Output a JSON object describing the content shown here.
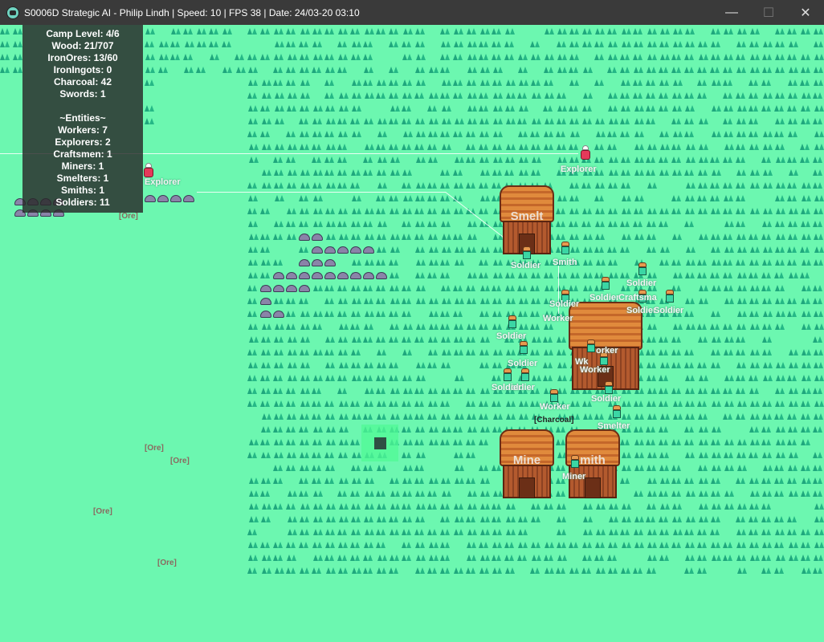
{
  "window": {
    "title": "S0006D Strategic AI - Philip Lindh | Speed: 10 | FPS 38 | Date: 24/03-20 03:10",
    "minimize": "—",
    "maximize": "☐",
    "close": "✕"
  },
  "hud": {
    "camp_level": "Camp Level: 4/6",
    "wood": "Wood: 21/707",
    "iron_ores": "IronOres: 13/60",
    "iron_ingots": "IronIngots: 0",
    "charcoal": "Charcoal: 42",
    "swords": "Swords: 1",
    "entities_header": "~Entities~",
    "workers": "Workers: 7",
    "explorers": "Explorers: 2",
    "craftsmen": "Craftsmen: 1",
    "miners": "Miners: 1",
    "smelters": "Smelters: 1",
    "smiths": "Smiths: 1",
    "soldiers": "Soldiers: 11"
  },
  "buildings": {
    "smelt": "Smelt",
    "mine": "Mine",
    "smith": "mith"
  },
  "resource_labels": {
    "charcoal": "[Charcoal]",
    "ore": "[Ore]"
  },
  "unit_labels": {
    "explorer": "Explorer",
    "soldier": "Soldier",
    "smith": "Smith",
    "worker": "Worker",
    "craftsman": "Craftsman",
    "smelter": "Smelter",
    "miner": "Miner",
    "worker_trunc": "orker",
    "soldier_trunc": "oldier",
    "craftsman_trunc": "Craftsma",
    "worker_short": "Wk"
  },
  "colors": {
    "ground": "#6cf7b0",
    "grass": "#1fa77d",
    "hud_bg": "#282828",
    "titlebar": "#3a3a3a"
  }
}
